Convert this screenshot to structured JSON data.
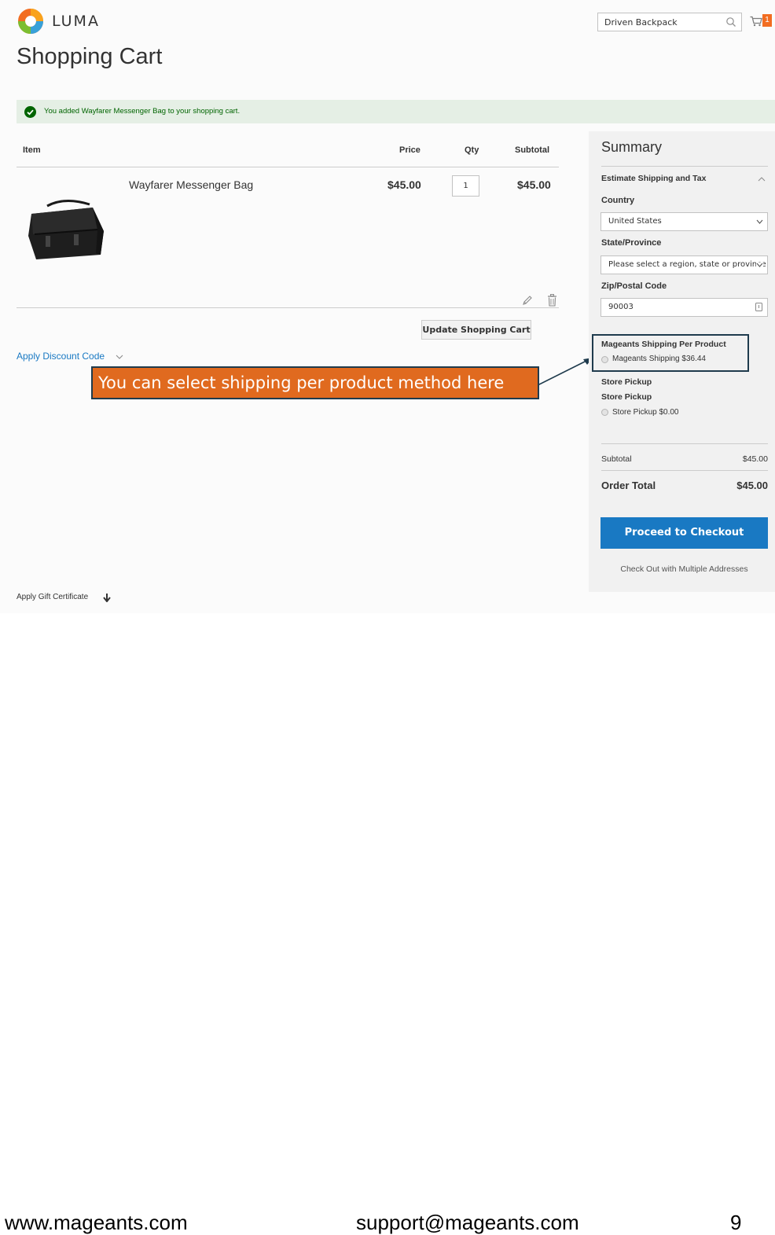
{
  "brand": {
    "name": "LUMA"
  },
  "header": {
    "search_value": "Driven Backpack",
    "cart_count": "1"
  },
  "page_title": "Shopping Cart",
  "message": "You added Wayfarer Messenger Bag to your shopping cart.",
  "cart": {
    "columns": {
      "item": "Item",
      "price": "Price",
      "qty": "Qty",
      "subtotal": "Subtotal"
    },
    "items": [
      {
        "name": "Wayfarer Messenger Bag",
        "price": "$45.00",
        "qty": "1",
        "subtotal": "$45.00"
      }
    ],
    "update_button": "Update Shopping Cart",
    "discount_link": "Apply Discount Code",
    "gift_link": "Apply Gift Certificate"
  },
  "callout": "You can select shipping per product method here",
  "summary": {
    "title": "Summary",
    "estimate_label": "Estimate Shipping and Tax",
    "country_label": "Country",
    "country_value": "United States",
    "state_label": "State/Province",
    "state_value": "Please select a region, state or province",
    "zip_label": "Zip/Postal Code",
    "zip_value": "90003",
    "shipping_methods": [
      {
        "carrier": "Mageants Shipping Per Product",
        "option": "Mageants Shipping $36.44"
      },
      {
        "carrier": "Store Pickup",
        "subcarrier": "Store Pickup",
        "option": "Store Pickup $0.00"
      }
    ],
    "subtotal_label": "Subtotal",
    "subtotal_value": "$45.00",
    "order_total_label": "Order Total",
    "order_total_value": "$45.00",
    "checkout_button": "Proceed to Checkout",
    "multi_address_link": "Check Out with Multiple Addresses"
  },
  "footer": {
    "website": "www.mageants.com",
    "email": "support@mageants.com",
    "page_number": "9"
  },
  "colors": {
    "accent_blue": "#1979c3",
    "brand_orange": "#f26d21",
    "callout_orange": "#e06a1f",
    "success_bg": "#e5efe5",
    "success_text": "#006400"
  }
}
